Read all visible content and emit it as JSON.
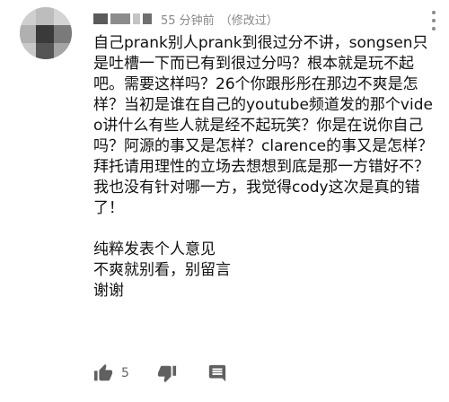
{
  "comment": {
    "time_ago": "55 分钟前",
    "edited": "（修改过）",
    "text": "自己prank别人prank到很过分不讲，songsen只是吐槽一下而已有到很过分吗？根本就是玩不起吧。需要这样吗？26个你跟彤彤在那边不爽是怎样？当初是谁在自己的youtube频道发的那个video讲什么有些人就是经不起玩笑？你是在说你自己吗？阿源的事又是怎样？clarence的事又是怎样？拜托请用理性的立场去想想到底是那一方错好不？\n我也没有针对哪一方，我觉得cody这次是真的错了！\n\n纯粹发表个人意见\n不爽就别看，别留言\n谢谢",
    "like_count": "5"
  },
  "icons": {
    "avatar": "avatar-mosaic",
    "menu": "more-vert-icon",
    "like": "thumb-up-icon",
    "dislike": "thumb-down-icon",
    "reply": "reply-comment-icon"
  },
  "colors": {
    "meta_text": "#888888",
    "icon": "#606060",
    "body_text": "#111111"
  }
}
